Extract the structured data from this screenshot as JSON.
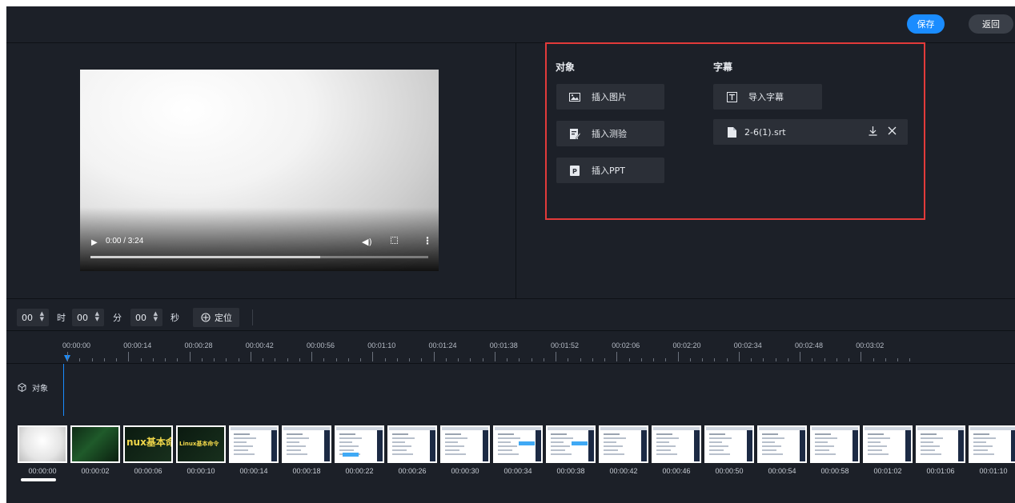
{
  "header": {
    "save_label": "保存",
    "back_label": "返回"
  },
  "player": {
    "time": "0:00 / 3:24",
    "progress": 0.68
  },
  "objects": {
    "title": "对象",
    "buttons": [
      "插入图片",
      "插入测验",
      "插入PPT"
    ]
  },
  "subtitles": {
    "title": "字幕",
    "import_label": "导入字幕",
    "file_name": "2-6(1).srt"
  },
  "time_input": {
    "hours": "00",
    "hours_unit": "时",
    "minutes": "00",
    "minutes_unit": "分",
    "seconds": "00",
    "seconds_unit": "秒",
    "locate_label": "定位"
  },
  "ruler": {
    "labels": [
      "00:00:00",
      "00:00:14",
      "00:00:28",
      "00:00:42",
      "00:00:56",
      "00:01:10",
      "00:01:24",
      "00:01:38",
      "00:01:52",
      "00:02:06",
      "00:02:20",
      "00:02:34",
      "00:02:48",
      "00:03:02"
    ]
  },
  "track": {
    "object_label": "对象"
  },
  "thumbnails": {
    "labels": [
      "00:00:00",
      "00:00:02",
      "00:00:06",
      "00:00:10",
      "00:00:14",
      "00:00:18",
      "00:00:22",
      "00:00:26",
      "00:00:30",
      "00:00:34",
      "00:00:38",
      "00:00:42",
      "00:00:46",
      "00:00:50",
      "00:00:54",
      "00:00:58",
      "00:01:02",
      "00:01:06",
      "00:01:10"
    ],
    "frame_text_1": "nux基本命",
    "frame_text_2": "Linux基本命令"
  }
}
